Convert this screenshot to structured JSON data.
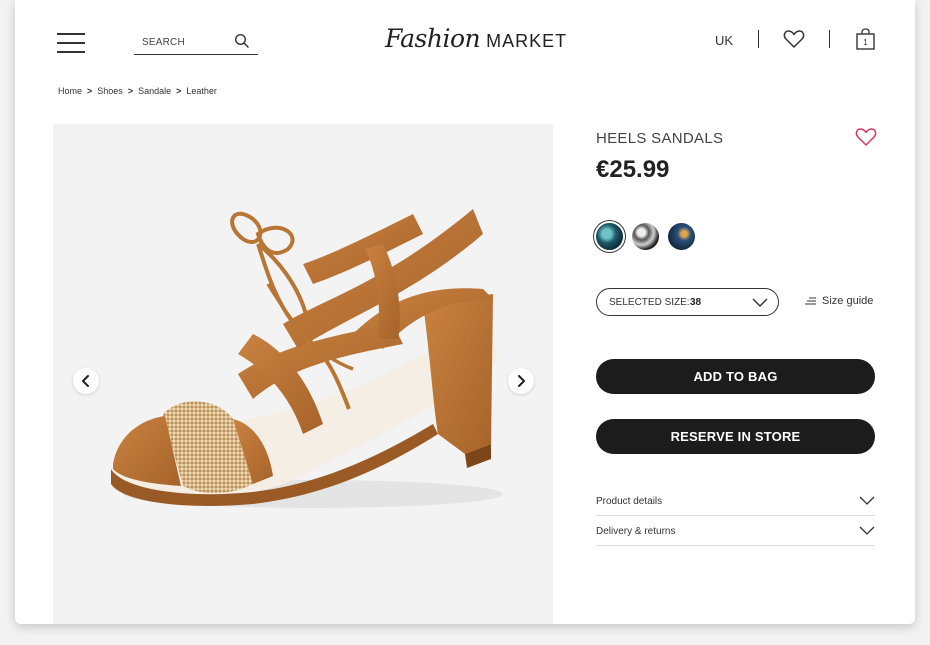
{
  "header": {
    "search_placeholder": "SEARCH",
    "logo_script": "Fashion",
    "logo_word": "MARKET",
    "region": "UK",
    "bag_count": "1",
    "icons": [
      "menu-icon",
      "search-icon",
      "heart-icon",
      "bag-icon"
    ]
  },
  "breadcrumb": {
    "items": [
      "Home",
      "Shoes",
      "Sandale",
      "Leather"
    ],
    "separator": ">"
  },
  "product": {
    "title": "HEELS SANDALS",
    "price": "€25.99",
    "size_label": "SELECTED SIZE:",
    "size_value": "38",
    "size_guide": "Size guide",
    "add_to_bag": "ADD TO BAG",
    "reserve": "RESERVE IN STORE",
    "accordions": [
      "Product details",
      "Delivery & returns"
    ],
    "swatches": [
      "teal-pattern",
      "black-white-pattern",
      "navy-pattern"
    ]
  },
  "colors": {
    "button_bg": "#1c1c1c",
    "wishlist_heart": "#d6375a",
    "shoe": "#b8702f",
    "gallery_bg": "#f3f3f3"
  }
}
